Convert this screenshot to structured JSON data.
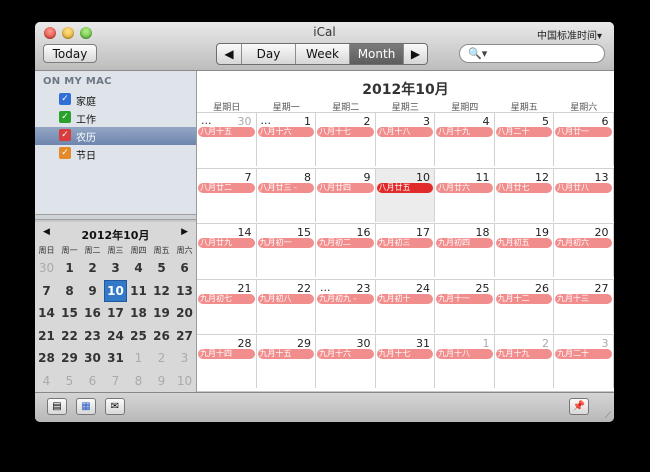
{
  "window": {
    "title": "iCal",
    "timezone": "中国标准时间▾"
  },
  "toolbar": {
    "today": "Today",
    "views": [
      "Day",
      "Week",
      "Month"
    ],
    "active_view": "Month",
    "prev": "◀",
    "next": "▶",
    "search_placeholder": ""
  },
  "sidebar": {
    "section": "ON MY MAC",
    "calendars": [
      {
        "label": "家庭",
        "color": "#2f6fd6",
        "selected": false
      },
      {
        "label": "工作",
        "color": "#2aa12a",
        "selected": false
      },
      {
        "label": "农历",
        "color": "#d83c3c",
        "selected": true
      },
      {
        "label": "节日",
        "color": "#e58a2a",
        "selected": false
      }
    ]
  },
  "mini": {
    "title": "2012年10月",
    "prev": "◀",
    "next": "▶",
    "dow": [
      "周日",
      "周一",
      "周二",
      "周三",
      "周四",
      "周五",
      "周六"
    ],
    "weeks": [
      [
        [
          "30",
          1
        ],
        [
          "1",
          0
        ],
        [
          "2",
          0
        ],
        [
          "3",
          0
        ],
        [
          "4",
          0
        ],
        [
          "5",
          0
        ],
        [
          "6",
          0
        ]
      ],
      [
        [
          "7",
          0
        ],
        [
          "8",
          0
        ],
        [
          "9",
          0
        ],
        [
          "10",
          2
        ],
        [
          "11",
          0
        ],
        [
          "12",
          0
        ],
        [
          "13",
          0
        ]
      ],
      [
        [
          "14",
          0
        ],
        [
          "15",
          0
        ],
        [
          "16",
          0
        ],
        [
          "17",
          0
        ],
        [
          "18",
          0
        ],
        [
          "19",
          0
        ],
        [
          "20",
          0
        ]
      ],
      [
        [
          "21",
          0
        ],
        [
          "22",
          0
        ],
        [
          "23",
          0
        ],
        [
          "24",
          0
        ],
        [
          "25",
          0
        ],
        [
          "26",
          0
        ],
        [
          "27",
          0
        ]
      ],
      [
        [
          "28",
          0
        ],
        [
          "29",
          0
        ],
        [
          "30",
          0
        ],
        [
          "31",
          0
        ],
        [
          "1",
          1
        ],
        [
          "2",
          1
        ],
        [
          "3",
          1
        ]
      ],
      [
        [
          "4",
          1
        ],
        [
          "5",
          1
        ],
        [
          "6",
          1
        ],
        [
          "7",
          1
        ],
        [
          "8",
          1
        ],
        [
          "9",
          1
        ],
        [
          "10",
          1
        ]
      ]
    ]
  },
  "main": {
    "title": "2012年10月",
    "dow": [
      "星期日",
      "星期一",
      "星期二",
      "星期三",
      "星期四",
      "星期五",
      "星期六"
    ],
    "weeks": [
      [
        {
          "d": "30",
          "dim": true,
          "more": "...",
          "ev": "八月十五"
        },
        {
          "d": "1",
          "more": "...",
          "ev": "八月十六"
        },
        {
          "d": "2",
          "ev": "八月十七"
        },
        {
          "d": "3",
          "ev": "八月十八"
        },
        {
          "d": "4",
          "ev": "八月十九"
        },
        {
          "d": "5",
          "ev": "八月二十"
        },
        {
          "d": "6",
          "ev": "八月廿一"
        }
      ],
      [
        {
          "d": "7",
          "ev": "八月廿二"
        },
        {
          "d": "8",
          "ev": "八月廿三 -"
        },
        {
          "d": "9",
          "ev": "八月廿四"
        },
        {
          "d": "10",
          "ev": "八月廿五",
          "today": true
        },
        {
          "d": "11",
          "ev": "八月廿六"
        },
        {
          "d": "12",
          "ev": "八月廿七"
        },
        {
          "d": "13",
          "ev": "八月廿八"
        }
      ],
      [
        {
          "d": "14",
          "ev": "八月廿九"
        },
        {
          "d": "15",
          "ev": "九月初一"
        },
        {
          "d": "16",
          "ev": "九月初二"
        },
        {
          "d": "17",
          "ev": "九月初三"
        },
        {
          "d": "18",
          "ev": "九月初四"
        },
        {
          "d": "19",
          "ev": "九月初五"
        },
        {
          "d": "20",
          "ev": "九月初六"
        }
      ],
      [
        {
          "d": "21",
          "ev": "九月初七"
        },
        {
          "d": "22",
          "ev": "九月初八"
        },
        {
          "d": "23",
          "more": "...",
          "ev": "九月初九 -"
        },
        {
          "d": "24",
          "ev": "九月初十"
        },
        {
          "d": "25",
          "ev": "九月十一"
        },
        {
          "d": "26",
          "ev": "九月十二"
        },
        {
          "d": "27",
          "ev": "九月十三"
        }
      ],
      [
        {
          "d": "28",
          "ev": "九月十四"
        },
        {
          "d": "29",
          "ev": "九月十五"
        },
        {
          "d": "30",
          "ev": "九月十六"
        },
        {
          "d": "31",
          "ev": "九月十七"
        },
        {
          "d": "1",
          "dim": true,
          "ev": "九月十八"
        },
        {
          "d": "2",
          "dim": true,
          "ev": "九月十九"
        },
        {
          "d": "3",
          "dim": true,
          "ev": "九月二十"
        }
      ]
    ]
  }
}
